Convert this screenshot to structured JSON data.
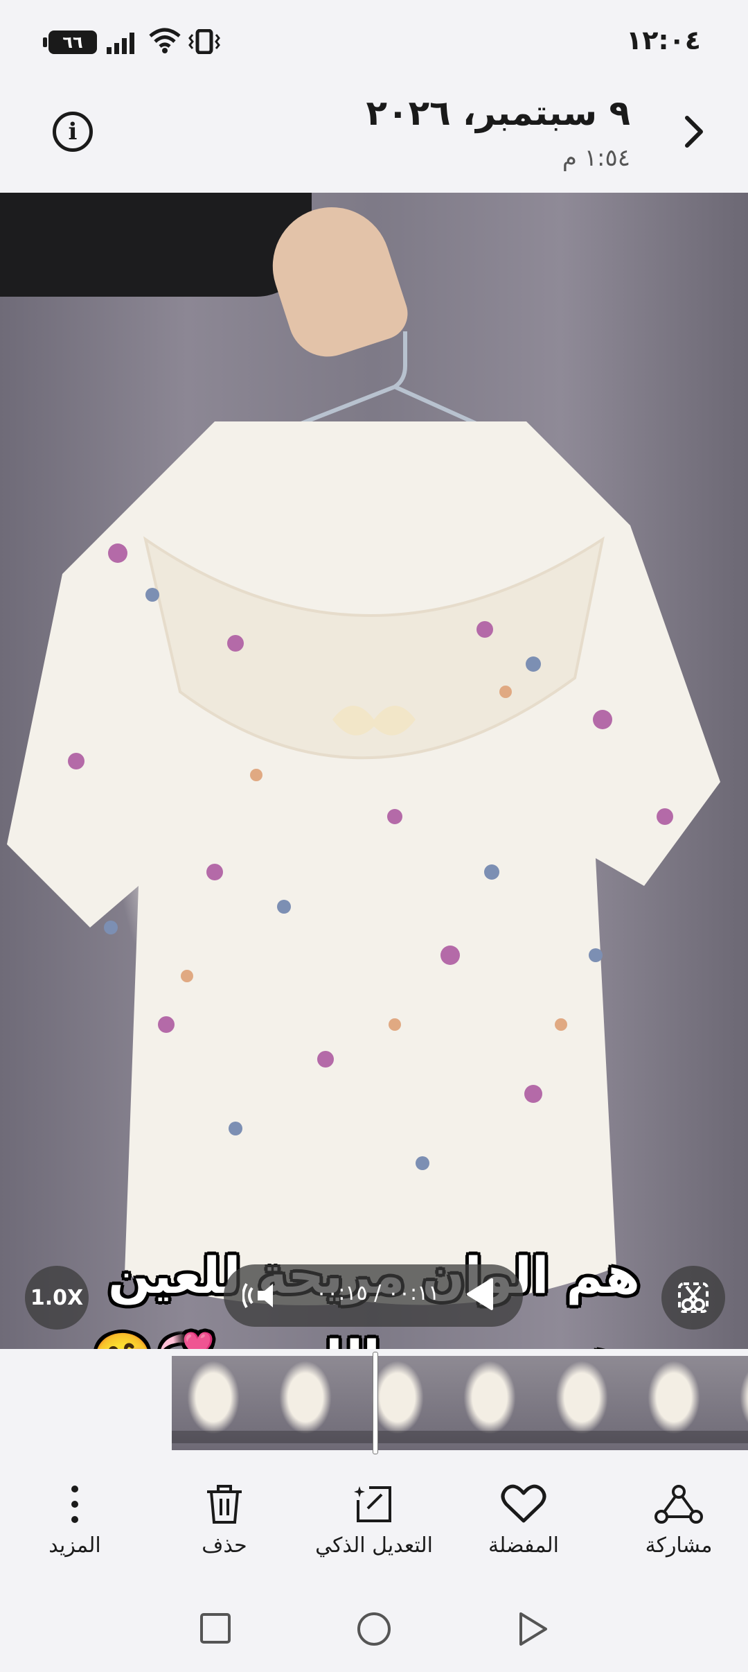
{
  "status_bar": {
    "time": "١٢:٠٤",
    "battery": "٦٦"
  },
  "header": {
    "date": "٩ سبتمبر، ٢٠٢٦",
    "time": "١:٥٤ م"
  },
  "photo": {
    "caption_line1": "هم الوان مريحة للعين",
    "caption_line2": "وهم مريح باللبس 💞🤗"
  },
  "player": {
    "speed": "1.0X",
    "time_display": "٠٠:١١ / ٠٠:١٥",
    "progress": 0.73
  },
  "actions": [
    {
      "label": "مشاركة",
      "icon": "share-icon"
    },
    {
      "label": "المفضلة",
      "icon": "heart-icon"
    },
    {
      "label": "التعديل الذكي",
      "icon": "magic-edit-icon"
    },
    {
      "label": "حذف",
      "icon": "trash-icon"
    },
    {
      "label": "المزيد",
      "icon": "more-icon"
    }
  ],
  "colors": {
    "background": "#f3f3f6",
    "text": "#1a1a1a",
    "overlay": "#3c3c3c"
  }
}
